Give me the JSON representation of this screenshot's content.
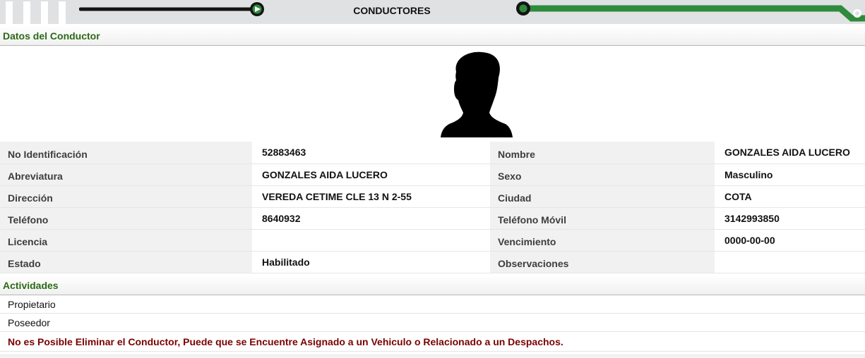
{
  "header": {
    "title": "CONDUCTORES"
  },
  "sections": {
    "driver_data": "Datos del Conductor",
    "activities": "Actividades"
  },
  "details": {
    "rows": [
      {
        "left_label": "No Identificación",
        "left_value": "52883463",
        "right_label": "Nombre",
        "right_value": "GONZALES AIDA LUCERO"
      },
      {
        "left_label": "Abreviatura",
        "left_value": "GONZALES AIDA LUCERO",
        "right_label": "Sexo",
        "right_value": "Masculino"
      },
      {
        "left_label": "Dirección",
        "left_value": "VEREDA CETIME CLE 13 N 2-55",
        "right_label": "Ciudad",
        "right_value": "COTA"
      },
      {
        "left_label": "Teléfono",
        "left_value": "8640932",
        "right_label": "Teléfono Móvil",
        "right_value": "3142993850"
      },
      {
        "left_label": "Licencia",
        "left_value": "",
        "right_label": "Vencimiento",
        "right_value": "0000-00-00"
      },
      {
        "left_label": "Estado",
        "left_value": "Habilitado",
        "right_label": "Observaciones",
        "right_value": ""
      }
    ]
  },
  "activities": {
    "items": [
      "Propietario",
      "Poseedor"
    ],
    "warning": "No es Posible Eliminar el Conductor, Puede que se Encuentre Asignado a un Vehiculo o Relacionado a un Despachos."
  },
  "colors": {
    "section_heading": "#2b6a16",
    "warning_text": "#7a0000",
    "progress_green": "#2e8b3c",
    "label_background": "#f1f1f1"
  }
}
